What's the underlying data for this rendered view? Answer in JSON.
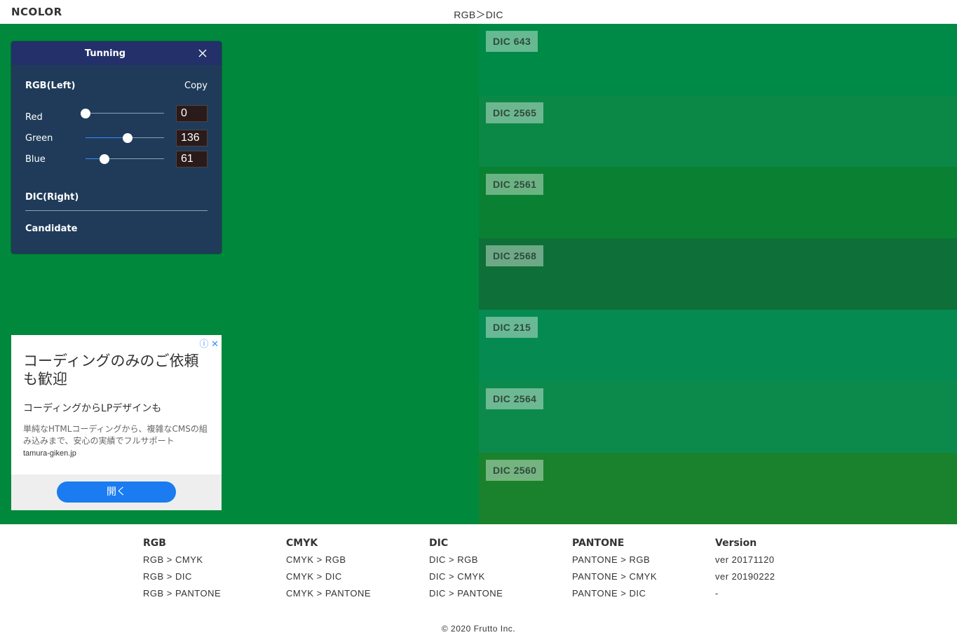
{
  "header": {
    "logo": "NCOLOR",
    "title": "RGB＞DIC"
  },
  "colors": {
    "left_color": "#00883d"
  },
  "panel": {
    "title": "Tunning",
    "close_icon": "close-icon",
    "rgb_label": "RGB(Left)",
    "copy_label": "Copy",
    "channels": [
      {
        "label": "Red",
        "value": "0",
        "fraction": 0
      },
      {
        "label": "Green",
        "value": "136",
        "fraction": 0.533
      },
      {
        "label": "Blue",
        "value": "61",
        "fraction": 0.239
      }
    ],
    "dic_label": "DIC(Right)",
    "candidate_label": "Candidate"
  },
  "swatches": [
    {
      "name": "DIC 643",
      "color": "#008a48"
    },
    {
      "name": "DIC 2565",
      "color": "#0b8746"
    },
    {
      "name": "DIC 2561",
      "color": "#0a8132"
    },
    {
      "name": "DIC 2568",
      "color": "#0e7038"
    },
    {
      "name": "DIC 215",
      "color": "#058b52"
    },
    {
      "name": "DIC 2564",
      "color": "#0c8a4c"
    },
    {
      "name": "DIC 2560",
      "color": "#1a822c"
    }
  ],
  "ad": {
    "info_icon": "ⓘ",
    "close_icon": "✕",
    "headline": "コーディングのみのご依頼も歓迎",
    "subheadline": "コーディングからLPデザインも",
    "description": "単純なHTMLコーディングから、複雑なCMSの組み込みまで、安心の実績でフルサポート",
    "domain": "tamura-giken.jp",
    "button": "開く"
  },
  "footer": {
    "columns": [
      {
        "title": "RGB",
        "links": [
          "RGB > CMYK",
          "RGB > DIC",
          "RGB > PANTONE"
        ]
      },
      {
        "title": "CMYK",
        "links": [
          "CMYK > RGB",
          "CMYK > DIC",
          "CMYK > PANTONE"
        ]
      },
      {
        "title": "DIC",
        "links": [
          "DIC > RGB",
          "DIC > CMYK",
          "DIC > PANTONE"
        ]
      },
      {
        "title": "PANTONE",
        "links": [
          "PANTONE > RGB",
          "PANTONE > CMYK",
          "PANTONE > DIC"
        ]
      },
      {
        "title": "Version",
        "links": [
          "ver 20171120",
          "ver 20190222",
          "-"
        ]
      }
    ],
    "copyright": "© 2020 Frutto Inc."
  }
}
